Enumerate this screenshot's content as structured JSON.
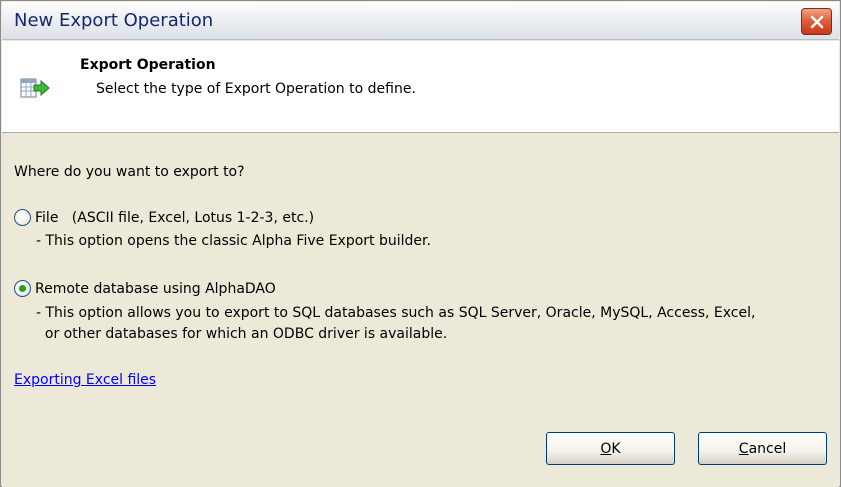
{
  "window": {
    "title": "New Export Operation",
    "close_icon": "close-icon",
    "close_color": "#d9512c"
  },
  "header": {
    "title": "Export Operation",
    "subtitle": "Select the type of Export Operation to define.",
    "icon": "table-export-icon"
  },
  "body": {
    "question": "Where do you want to export to?",
    "options": [
      {
        "label": "File   (ASCII file, Excel, Lotus 1-2-3, etc.)",
        "selected": false,
        "description": [
          "- This option opens the classic Alpha Five Export builder."
        ]
      },
      {
        "label": "Remote database using AlphaDAO",
        "selected": true,
        "description": [
          "- This option allows you to export to SQL databases such as SQL Server, Oracle, MySQL, Access, Excel,",
          "  or other databases for which an ODBC driver is available."
        ]
      }
    ],
    "link": "Exporting Excel files"
  },
  "buttons": {
    "ok": {
      "underlined": "O",
      "rest": "K"
    },
    "cancel": {
      "underlined": "C",
      "rest": "ancel"
    }
  },
  "colors": {
    "title_text": "#14286e",
    "dialog_bg": "#ece9d8",
    "link": "#0000ff",
    "radio_dot": "#21a121"
  }
}
